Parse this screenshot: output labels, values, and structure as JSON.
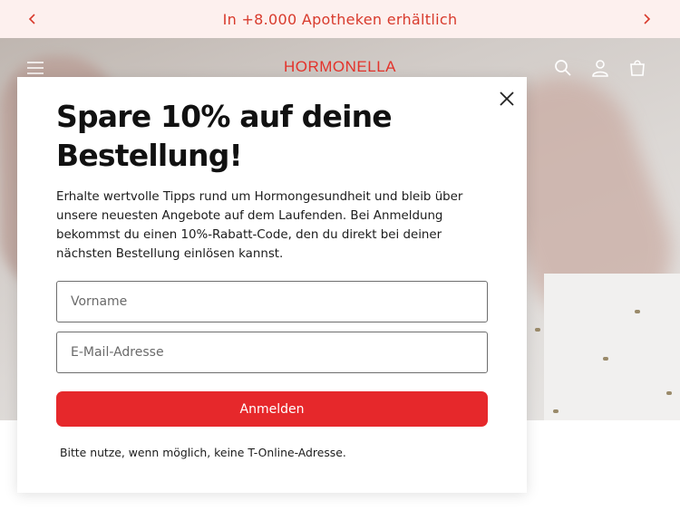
{
  "announcement": {
    "text": "In +8.000 Apotheken erhältlich",
    "prev_icon": "chevron-left-icon",
    "next_icon": "chevron-right-icon"
  },
  "header": {
    "logo": "HORMONELLA",
    "menu_icon": "hamburger-menu-icon",
    "search_icon": "search-icon",
    "account_icon": "user-icon",
    "cart_icon": "cart-icon"
  },
  "popup": {
    "title": "Spare 10% auf deine Bestellung!",
    "description": "Erhalte wertvolle Tipps rund um Hormongesundheit und bleib über unsere neuesten Angebote auf dem Laufenden. Bei Anmeldung bekommst du einen 10%-Rabatt-Code, den du direkt bei deiner nächsten Bestellung einlösen kannst.",
    "first_name_placeholder": "Vorname",
    "email_placeholder": "E-Mail-Adresse",
    "submit_label": "Anmelden",
    "note": "Bitte nutze, wenn möglich, keine T-Online-Adresse.",
    "close_icon": "close-icon"
  },
  "colors": {
    "accent": "#e6282b",
    "announcement_bg": "#fdf0ee",
    "announcement_text": "#d83a2c"
  }
}
